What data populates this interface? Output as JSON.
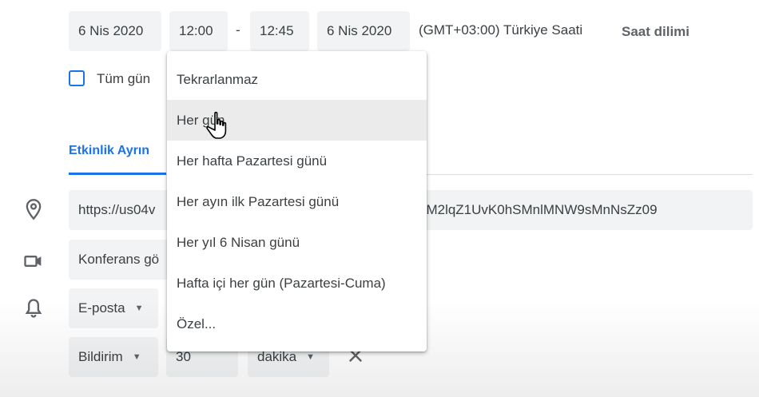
{
  "datetime_row": {
    "start_date": "6 Nis 2020",
    "start_time": "12:00",
    "separator": "-",
    "end_time": "12:45",
    "end_date": "6 Nis 2020",
    "timezone_text": "(GMT+03:00) Türkiye Saati",
    "timezone_button": "Saat dilimi"
  },
  "all_day": {
    "label": "Tüm gün",
    "checked": false
  },
  "tabs": {
    "details_label": "Etkinlik Ayrın"
  },
  "location": {
    "value_left": "https://us04v",
    "value_right": "uM2lqZ1UvK0hSMnlMNW9sMnNsZz09"
  },
  "conference": {
    "label": "Konferans gö"
  },
  "notification1": {
    "type": "E-posta"
  },
  "notification2": {
    "type": "Bildirim",
    "amount": "30",
    "unit": "dakika"
  },
  "repeat_menu": {
    "items": [
      "Tekrarlanmaz",
      "Her gün",
      "Her hafta Pazartesi günü",
      "Her ayın ilk Pazartesi günü",
      "Her yıl 6 Nisan günü",
      "Hafta içi her gün (Pazartesi-Cuma)",
      "Özel..."
    ],
    "hovered_index": 1
  },
  "icons": [
    "location-pin-icon",
    "video-camera-icon",
    "bell-icon",
    "close-icon",
    "hand-cursor-icon",
    "dropdown-arrow-icon"
  ],
  "colors": {
    "accent": "#1a73e8",
    "chip_bg": "#f1f3f4",
    "hover_bg": "#ebebeb"
  }
}
